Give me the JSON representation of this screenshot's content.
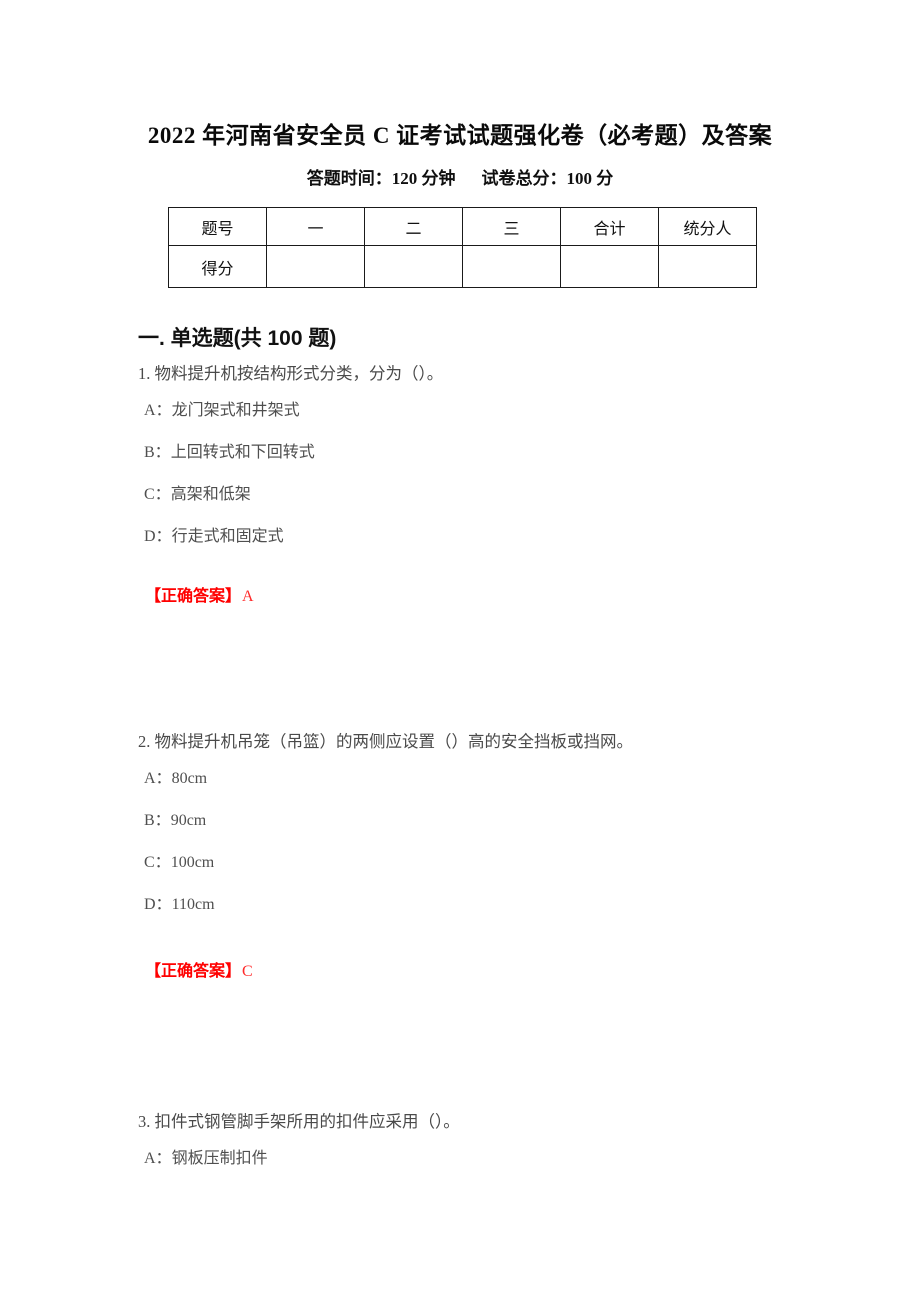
{
  "document": {
    "title": "2022 年河南省安全员 C 证考试试题强化卷（必考题）及答案",
    "subtitle_time": "答题时间：120 分钟",
    "subtitle_total": "试卷总分：100 分"
  },
  "score_table": {
    "headers": [
      "题号",
      "一",
      "二",
      "三",
      "合计",
      "统分人"
    ],
    "rows": [
      {
        "label": "得分",
        "cells": [
          "",
          "",
          "",
          "",
          ""
        ]
      }
    ]
  },
  "section": {
    "heading": "一. 单选题(共 100 题)"
  },
  "answer_label": "【正确答案】",
  "questions": [
    {
      "stem": "1. 物料提升机按结构形式分类，分为（）。",
      "options": [
        {
          "key": "A：",
          "text": "龙门架式和井架式"
        },
        {
          "key": "B：",
          "text": "上回转式和下回转式"
        },
        {
          "key": "C：",
          "text": "高架和低架"
        },
        {
          "key": "D：",
          "text": "行走式和固定式"
        }
      ],
      "answer": "A"
    },
    {
      "stem": "2. 物料提升机吊笼（吊篮）的两侧应设置（）高的安全挡板或挡网。",
      "options": [
        {
          "key": "A：",
          "text": "80cm"
        },
        {
          "key": "B：",
          "text": "90cm"
        },
        {
          "key": "C：",
          "text": "100cm"
        },
        {
          "key": "D：",
          "text": "110cm"
        }
      ],
      "answer": "C"
    },
    {
      "stem": "3. 扣件式钢管脚手架所用的扣件应采用（）。",
      "options": [
        {
          "key": "A：",
          "text": "钢板压制扣件"
        }
      ],
      "answer": ""
    }
  ]
}
